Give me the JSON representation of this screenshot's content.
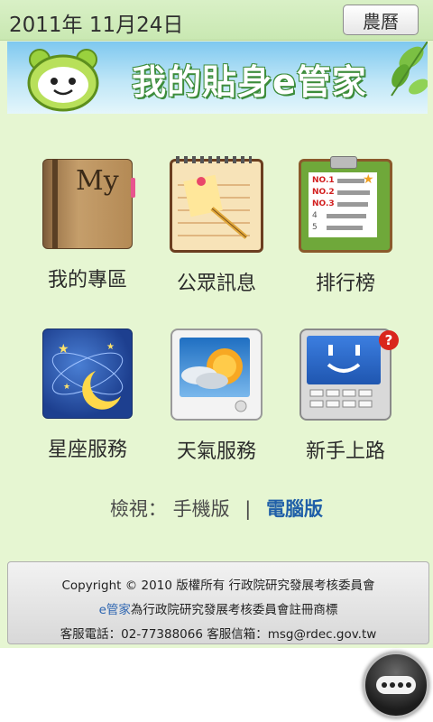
{
  "header": {
    "date": "2011年  11月24日",
    "lunar_button": "農曆"
  },
  "banner": {
    "title": "我的貼身e管家"
  },
  "menu": [
    {
      "label": "我的專區",
      "icon": "my-zone-book-icon"
    },
    {
      "label": "公眾訊息",
      "icon": "public-notice-notepad-icon"
    },
    {
      "label": "排行榜",
      "icon": "ranking-clipboard-icon"
    },
    {
      "label": "星座服務",
      "icon": "horoscope-moon-icon"
    },
    {
      "label": "天氣服務",
      "icon": "weather-sun-cloud-icon"
    },
    {
      "label": "新手上路",
      "icon": "beginner-guide-phone-icon"
    }
  ],
  "view_switch": {
    "prefix": "檢視：",
    "mobile": "手機版",
    "separator": "|",
    "pc": "電腦版"
  },
  "footer": {
    "line1": "Copyright © 2010 版權所有 行政院研究發展考核委員會",
    "brand": "e管家",
    "line2_rest": "為行政院研究發展考核委員會註冊商標",
    "line3": "客服電話：02-77388066 客服信箱：msg@rdec.gov.tw"
  },
  "ranking_icon_rows": [
    "NO.1",
    "NO.2",
    "NO.3",
    "4",
    "5"
  ],
  "colors": {
    "background": "#e6f6d2",
    "pc_link": "#1f5fa8",
    "banner_text_outline": "#3c8c3a"
  }
}
